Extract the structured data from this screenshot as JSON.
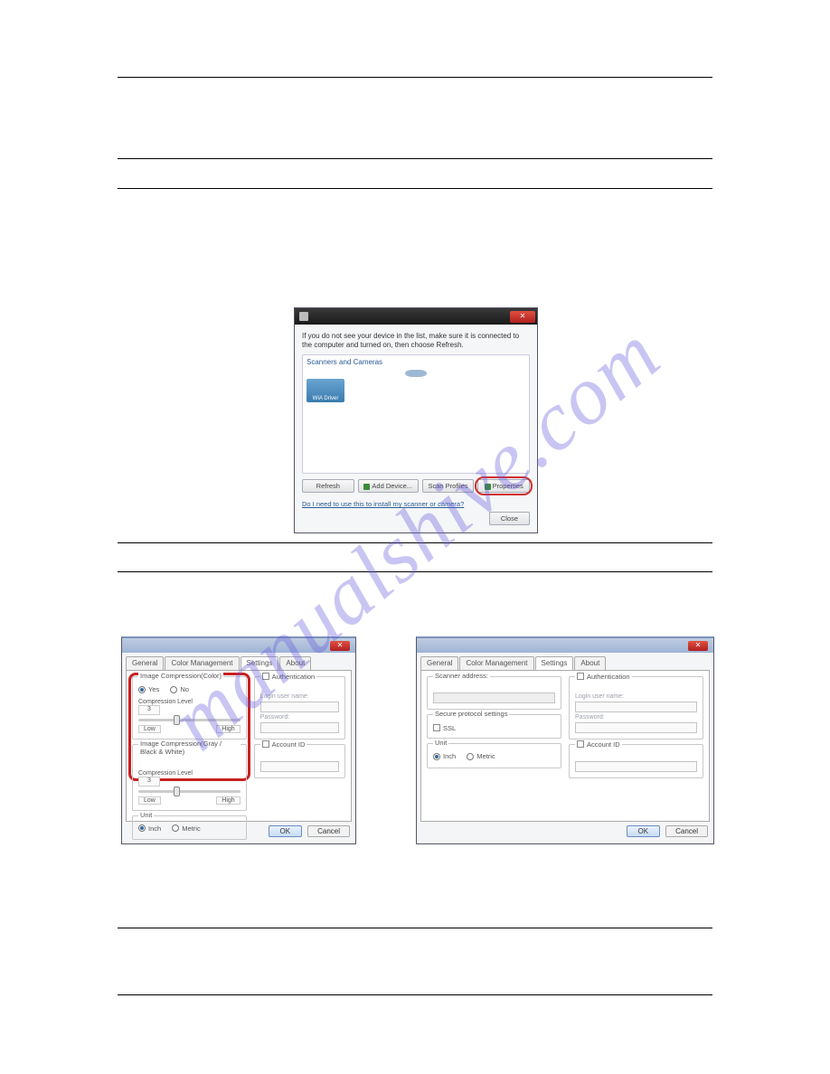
{
  "watermark": "manualshive.com",
  "main_dialog": {
    "instruction": "If you do not see your device in the list, make sure it is connected to the computer and turned on, then choose Refresh.",
    "group_label": "Scanners and Cameras",
    "device_label": "WIA Driver",
    "buttons": {
      "refresh": "Refresh",
      "add_device": "Add Device...",
      "scan_profiles": "Scan Profiles",
      "properties": "Properties"
    },
    "link": "Do I need to use this to install my scanner or camera?",
    "close": "Close"
  },
  "prop_dialog": {
    "tabs": {
      "general": "General",
      "color_mgmt": "Color Management",
      "settings": "Settings",
      "about": "About"
    },
    "image_comp_color": "Image Compression(Color)",
    "yes": "Yes",
    "no": "No",
    "compression_level": "Compression Level",
    "low": "Low",
    "high": "High",
    "image_comp_bw": "Image Compression(Gray / Black & White)",
    "comp_value": "3",
    "unit": "Unit",
    "inch": "Inch",
    "metric": "Metric",
    "auth": "Authentication",
    "login_user": "Login user name:",
    "password": "Password:",
    "account_id": "Account ID",
    "account_id_u": "Account ID",
    "scanner_address": "Scanner address:",
    "secure_protocol": "Secure protocol settings",
    "ssl": "SSL",
    "ok": "OK",
    "cancel": "Cancel"
  }
}
